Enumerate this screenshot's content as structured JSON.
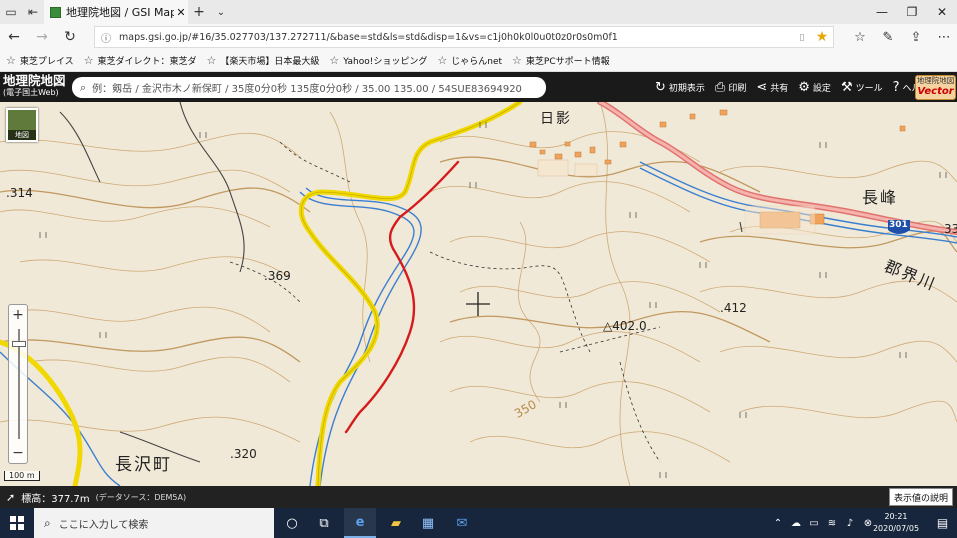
{
  "browser": {
    "tab_title": "地理院地図 / GSI Maps",
    "url": "maps.gsi.go.jp/#16/35.027703/137.272711/&base=std&ls=std&disp=1&vs=c1j0h0k0l0u0t0z0r0s0m0f1",
    "favorites": [
      "東芝プレイス",
      "東芝ダイレクト：東芝ダ",
      "【楽天市場】日本最大級",
      "Yahoo!ショッピング",
      "じゃらんnet",
      "東芝PCサポート情報"
    ]
  },
  "app": {
    "logo_title": "地理院地図",
    "logo_sub": "(電子国土Web)",
    "search_placeholder": "例：剱岳 / 金沢市木ノ新保町 / 35度0分0秒 135度0分0秒 / 35.00 135.00 / 54SUE83694920",
    "tools": {
      "home": "初期表示",
      "print": "印刷",
      "share": "共有",
      "settings": "設定",
      "tools": "ツール",
      "help": "ヘルプ"
    },
    "vector_line1": "地理院地図",
    "vector_line2": "Vector"
  },
  "map": {
    "thumb_label": "地図",
    "scale_label": "100 m",
    "elevations": [
      ".314",
      ".369",
      ".320",
      "△402.0",
      ".412",
      "33"
    ],
    "contour_label": "350",
    "places": [
      "日影",
      "長峰",
      "長沢町",
      "郡界川"
    ],
    "route_number": "301"
  },
  "status": {
    "elevation": "標高：377.7m",
    "source": "(データソース：DEM5A)",
    "legend_button": "表示値の説明"
  },
  "taskbar": {
    "search_placeholder": "ここに入力して検索",
    "time": "20:21",
    "date": "2020/07/05"
  }
}
